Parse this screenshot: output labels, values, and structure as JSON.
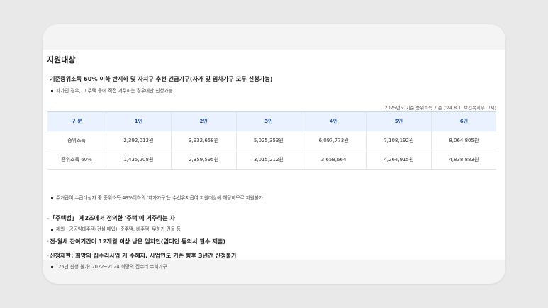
{
  "section_title": "지원대상",
  "block1": {
    "heading": "기준중위소득 60% 이하 반지하 및 자치구 추천 긴급가구(자가 및 임차가구 모두 신청가능)",
    "note": "자가인 경우, 그 주택 등에 직접 거주하는 경우에만 신청가능"
  },
  "table": {
    "caption": "2025년도 기준 중위소득 기준 ('24.8.1. 보건복지부 고시)",
    "headers": [
      "구 분",
      "1인",
      "2인",
      "3인",
      "4인",
      "5인",
      "6인"
    ],
    "rows": [
      [
        "중위소득",
        "2,392,013원",
        "3,932,658원",
        "5,025,353원",
        "6,097,773원",
        "7,108,192원",
        "8,064,805원"
      ],
      [
        "중위소득 60%",
        "1,435,208원",
        "2,359,595원",
        "3,015,212원",
        "3,658,664",
        "4,264,915원",
        "4,838,883원"
      ]
    ]
  },
  "table_note": "주거급여 수급대상자 중 중위소득 48%이하의 '자가가구'는 수선유지급여 지원대상에 해당하므로 지원불가",
  "block2": {
    "heading": "「주택법」 제2조에서 정의한 '주택'에 거주하는 자",
    "note": "제외 : 공공임대주택(건설·매입), 준주택, 비주택, 무허가 건물 등"
  },
  "block3": {
    "heading": "전·월세 잔여기간이 12개월 이상 남은 임차인(임대인 동의서 필수 제출)"
  },
  "block4": {
    "heading": "신청제한: 희망의 집수리사업 기 수혜자, 사업연도 기준 향후 3년간 신청불가",
    "note": "`25년 신청 불가: 2022~2024 희망의 집수리 수혜가구"
  }
}
